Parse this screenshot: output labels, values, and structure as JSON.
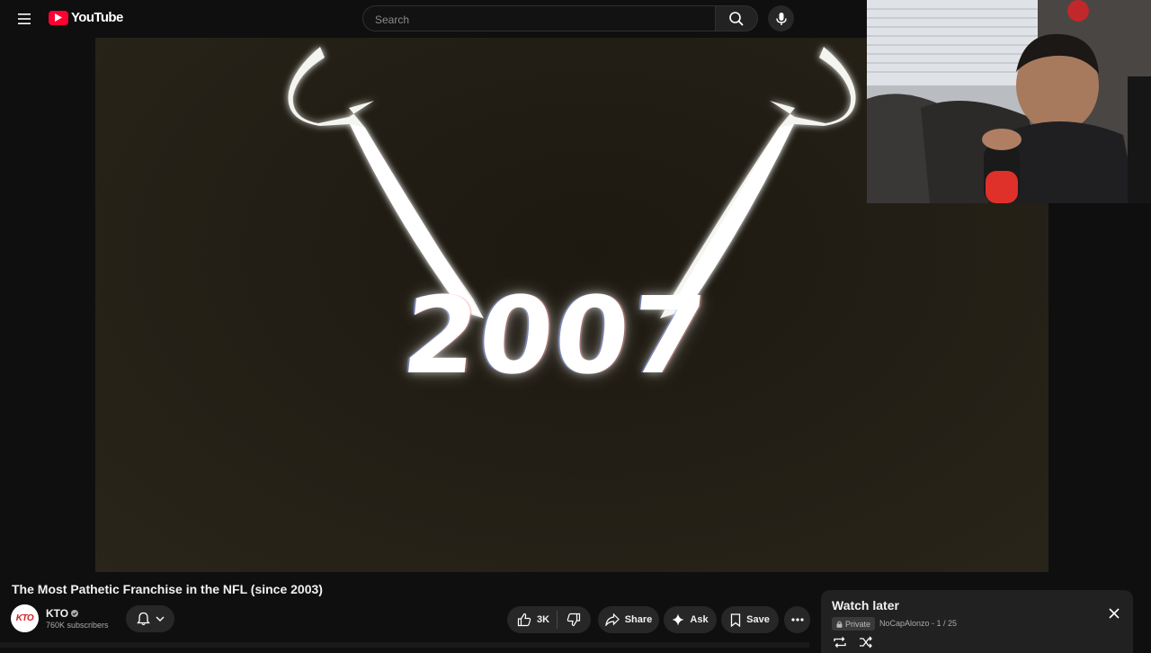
{
  "header": {
    "logo_text": "YouTube",
    "search_placeholder": "Search",
    "menu_icon": "hamburger-menu-icon",
    "search_icon": "search-icon",
    "mic_icon": "microphone-icon"
  },
  "video": {
    "overlay_text": "2007"
  },
  "video_info": {
    "title": "The Most Pathetic Franchise in the NFL (since 2003)",
    "channel": {
      "name": "KTO",
      "avatar_text": "KTO",
      "subscribers": "760K subscribers"
    },
    "actions": {
      "like_count": "3K",
      "share_label": "Share",
      "ask_label": "Ask",
      "save_label": "Save"
    }
  },
  "playlist": {
    "title": "Watch later",
    "privacy": "Private",
    "meta": "NoCapAlonzo - 1 / 25"
  },
  "colors": {
    "brand_red": "#ff0033",
    "background": "#0f0f0f",
    "panel": "#212121"
  }
}
